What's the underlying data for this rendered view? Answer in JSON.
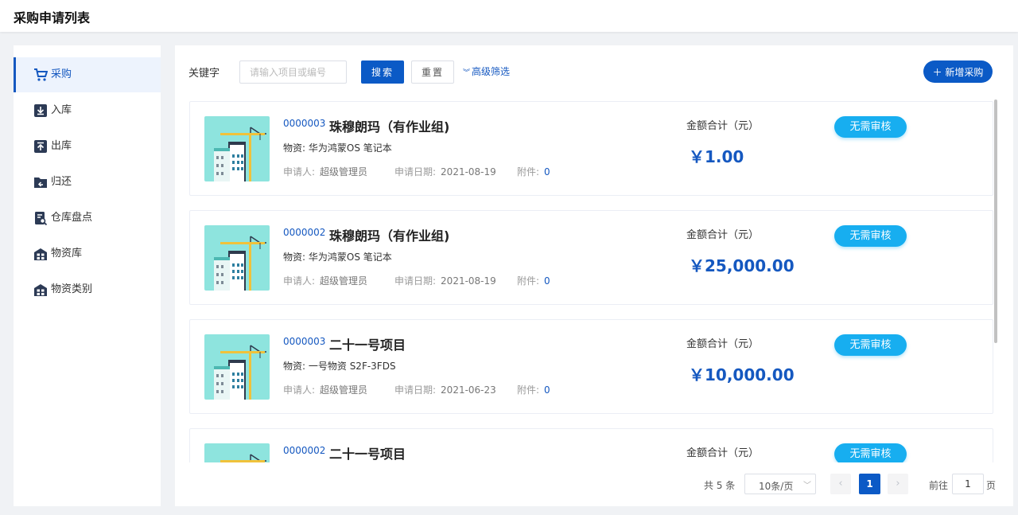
{
  "page": {
    "title": "采购申请列表"
  },
  "sidebar": {
    "items": [
      {
        "label": "采购",
        "icon": "cart-icon",
        "active": true
      },
      {
        "label": "入库",
        "icon": "download-icon"
      },
      {
        "label": "出库",
        "icon": "upload-icon"
      },
      {
        "label": "归还",
        "icon": "return-folder-icon"
      },
      {
        "label": "仓库盘点",
        "icon": "inventory-check-icon"
      },
      {
        "label": "物资库",
        "icon": "warehouse-icon"
      },
      {
        "label": "物资类别",
        "icon": "category-icon"
      }
    ]
  },
  "filter": {
    "keyword_label": "关键字",
    "keyword_placeholder": "请输入项目或编号",
    "search_label": "搜索",
    "reset_label": "重置",
    "advanced_label": "高级筛选",
    "add_label": "＋ 新增采购"
  },
  "card_labels": {
    "material": "物资:",
    "applicant": "申请人:",
    "date": "申请日期:",
    "attachment": "附件:",
    "amount": "金额合计（元）"
  },
  "records": [
    {
      "code": "0000003",
      "name": "珠穆朗玛（有作业组)",
      "material": "华为鸿蒙OS 笔记本",
      "applicant": "超级管理员",
      "date": "2021-08-19",
      "attachments": "0",
      "amount": "￥1.00",
      "status": "无需审核"
    },
    {
      "code": "0000002",
      "name": "珠穆朗玛（有作业组)",
      "material": "华为鸿蒙OS 笔记本",
      "applicant": "超级管理员",
      "date": "2021-08-19",
      "attachments": "0",
      "amount": "￥25,000.00",
      "status": "无需审核"
    },
    {
      "code": "0000003",
      "name": "二十一号项目",
      "material": "一号物资 S2F-3FDS",
      "applicant": "超级管理员",
      "date": "2021-06-23",
      "attachments": "0",
      "amount": "￥10,000.00",
      "status": "无需审核"
    },
    {
      "code": "0000002",
      "name": "二十一号项目",
      "material": "",
      "applicant": "",
      "date": "",
      "attachments": "",
      "amount": "",
      "status": "无需审核"
    }
  ],
  "pagination": {
    "total": "共 5 条",
    "page_size": "10条/页",
    "current": "1",
    "goto_label": "前往",
    "goto_value": "1",
    "goto_suffix": "页"
  },
  "colors": {
    "primary": "#0b5ac6",
    "badge": "#17aef0",
    "thumb_bg": "#8ee4de"
  }
}
